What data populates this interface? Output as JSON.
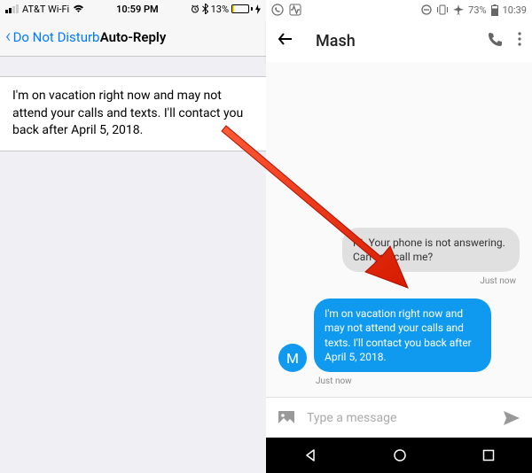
{
  "ios": {
    "statusbar": {
      "carrier": "AT&T Wi-Fi",
      "time": "10:59 PM",
      "battery": "13%"
    },
    "nav": {
      "back": "Do Not Disturb",
      "title": "Auto-Reply"
    },
    "message": "I'm on vacation right now and may not attend your calls and texts. I'll contact you back after April 5, 2018."
  },
  "android": {
    "statusbar": {
      "battery": "73%",
      "time": "10:39"
    },
    "header": {
      "title": "Mash"
    },
    "messages": {
      "incoming": {
        "text": "Hi. Your phone is not answering. Can you call me?",
        "timestamp": "Just now"
      },
      "outgoing": {
        "avatar": "M",
        "text": "I'm on vacation right now and may not attend your calls and texts. I'll contact you back after April 5, 2018.",
        "timestamp": "Just now"
      }
    },
    "input": {
      "placeholder": "Type a message"
    }
  }
}
